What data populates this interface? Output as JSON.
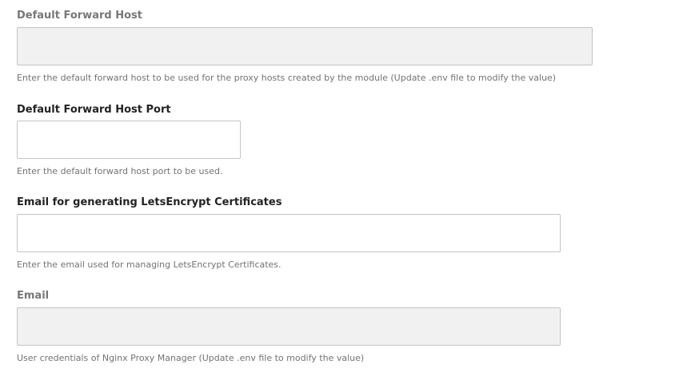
{
  "fields": [
    {
      "label": "Default Forward Host",
      "value": "",
      "disabled": true,
      "help": "Enter the default forward host to be used for the proxy hosts created by the module (Update .env file to modify the value)"
    },
    {
      "label": "Default Forward Host Port",
      "value": "",
      "disabled": false,
      "help": "Enter the default forward host port to be used."
    },
    {
      "label": "Email for generating LetsEncrypt Certificates",
      "value": "",
      "disabled": false,
      "help": "Enter the email used for managing LetsEncrypt Certificates."
    },
    {
      "label": "Email",
      "value": "",
      "disabled": true,
      "help": "User credentials of Nginx Proxy Manager (Update .env file to modify the value)"
    }
  ]
}
